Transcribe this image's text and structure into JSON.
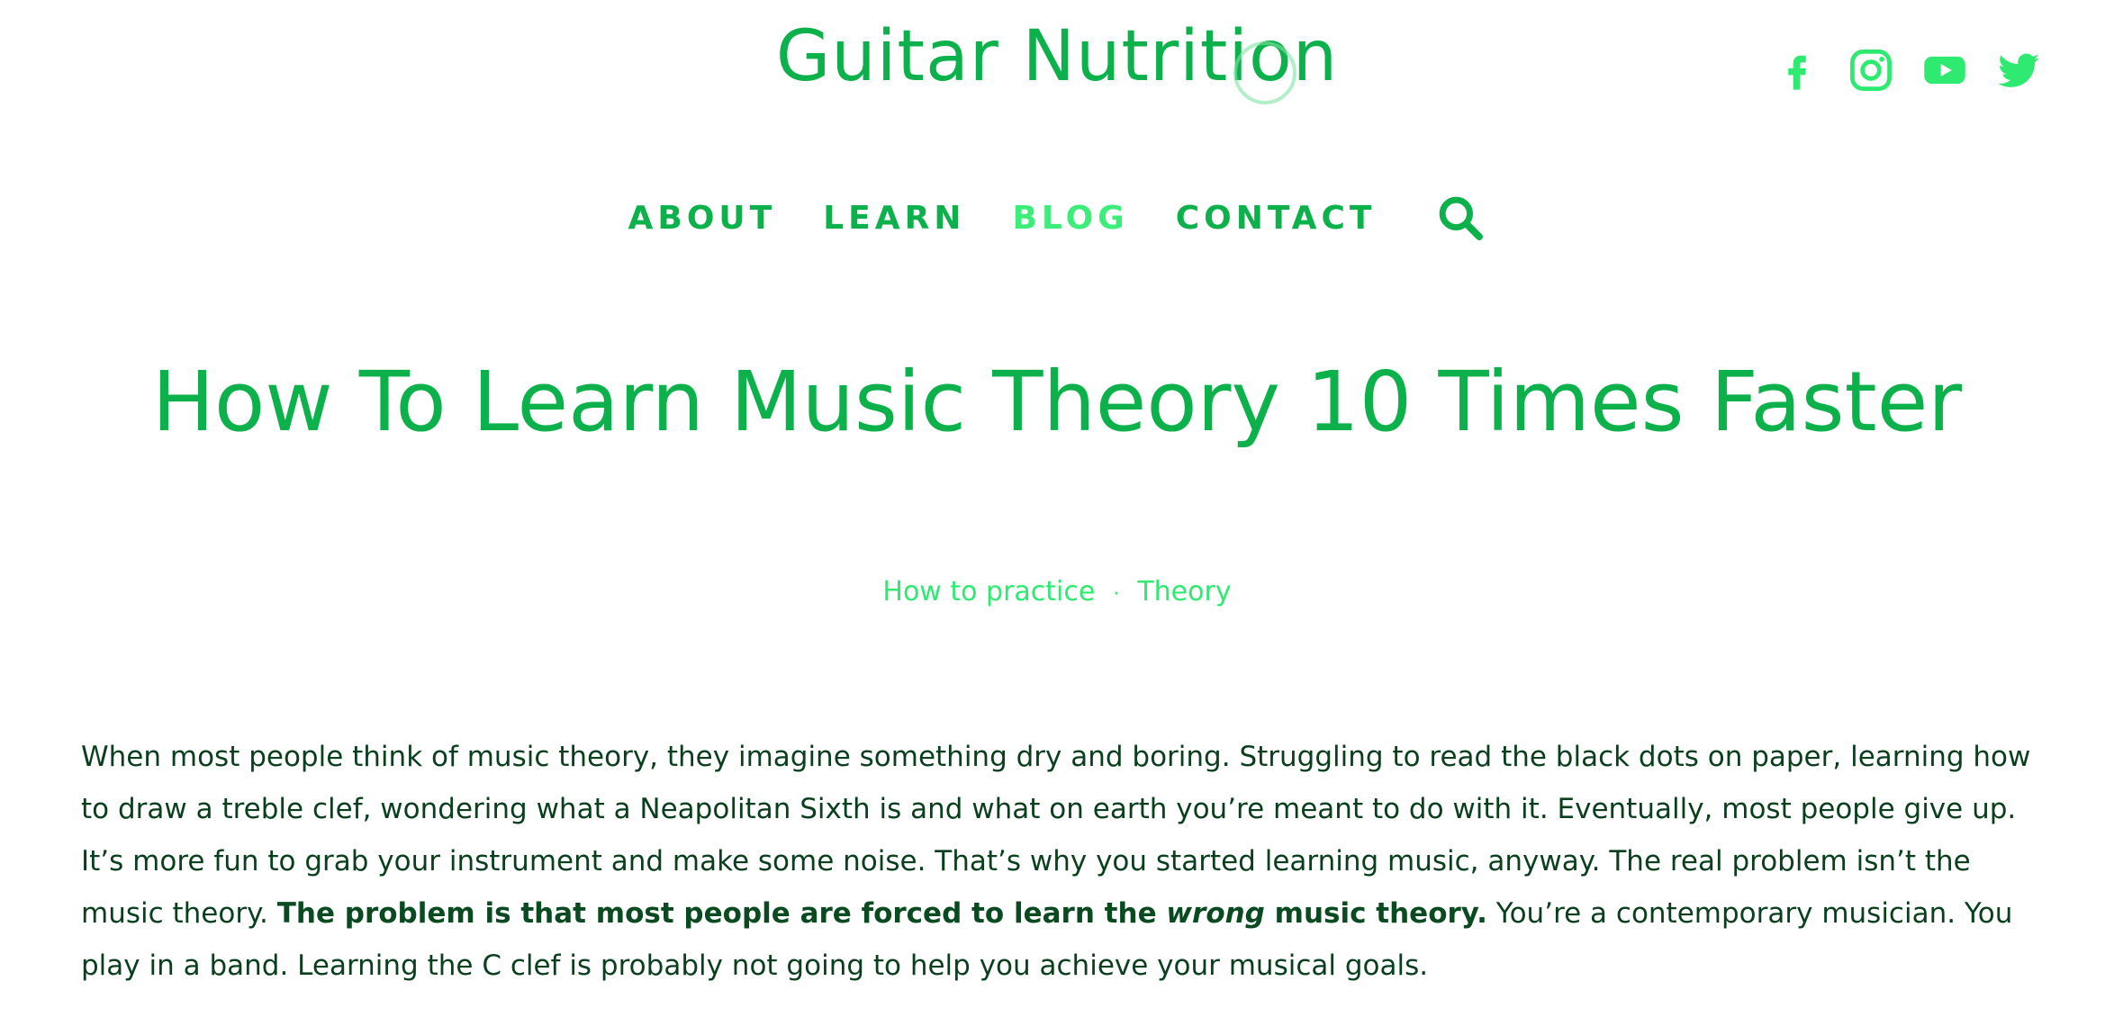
{
  "site": {
    "logo_text": "Guitar Nutrition"
  },
  "social": {
    "items": [
      {
        "name": "facebook"
      },
      {
        "name": "instagram"
      },
      {
        "name": "youtube"
      },
      {
        "name": "twitter"
      }
    ]
  },
  "nav": {
    "items": [
      "ABOUT",
      "LEARN",
      "BLOG",
      "CONTACT"
    ],
    "active": "BLOG"
  },
  "article": {
    "title": "How To Learn Music Theory 10 Times Faster",
    "categories": [
      "How to practice",
      "Theory"
    ],
    "separator": "·",
    "paragraph": {
      "part1": "When most people think of music theory, they imagine something dry and boring. Struggling to read the black dots on paper, learning how to draw a treble clef, wondering what a Neapolitan Sixth is and what on earth you’re meant to do with it. Eventually, most people give up. It’s more fun to grab your instrument and make some noise. That’s why you started learning music, anyway. The real problem isn’t the music theory. ",
      "bold1": "The problem is that most people are forced to learn the ",
      "bold_italic": "wrong",
      "bold2": " music theory.",
      "part2": " You’re a contemporary musician. You play in a band. Learning the C clef is probably not going to help you achieve your musical goals."
    }
  },
  "colors": {
    "brand_green": "#0db14b",
    "active_green": "#3ded7a",
    "body_text": "#0a3f1d"
  }
}
